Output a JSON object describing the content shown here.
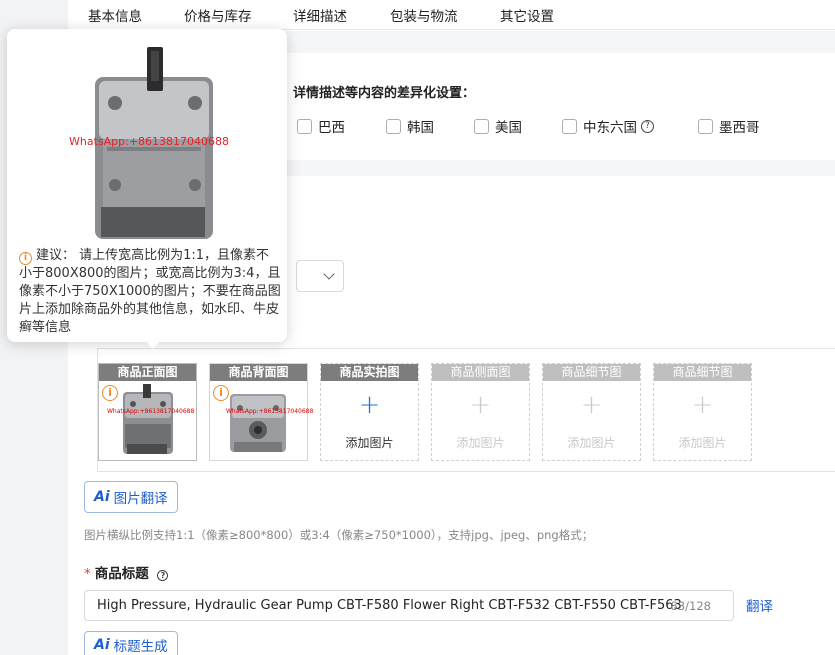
{
  "tabs": [
    "基本信息",
    "价格与库存",
    "详细描述",
    "包装与物流",
    "其它设置"
  ],
  "diff_section": {
    "title": "详情描述等内容的差异化设置：",
    "countries": [
      "巴西",
      "韩国",
      "美国",
      "中东六国",
      "墨西哥"
    ]
  },
  "popover": {
    "watermark": "WhatsApp:+8613817040688",
    "advice": "建议： 请上传宽高比例为1:1，且像素不小于800X800的图片；或宽高比例为3:4，且像素不小于750X1000的图片；不要在商品图片上添加除商品外的其他信息，如水印、牛皮癣等信息"
  },
  "image_slots": [
    {
      "caption": "商品正面图",
      "state": "filled",
      "watermark": "WhatsApp:+8613817040688"
    },
    {
      "caption": "商品背面图",
      "state": "filled",
      "watermark": "WhatsApp:+8613817040688"
    },
    {
      "caption": "商品实拍图",
      "state": "empty",
      "add_label": "添加图片"
    },
    {
      "caption": "商品侧面图",
      "state": "disabled",
      "add_label": "添加图片"
    },
    {
      "caption": "商品细节图",
      "state": "disabled",
      "add_label": "添加图片"
    },
    {
      "caption": "商品细节图",
      "state": "disabled",
      "add_label": "添加图片"
    }
  ],
  "image_translate_button": {
    "icon": "Ai",
    "label": "图片翻译"
  },
  "image_hint": "图片横纵比例支持1:1（像素≥800*800）或3:4（像素≥750*1000），支持jpg、jpeg、png格式；",
  "product_title": {
    "required_mark": "*",
    "label": "商品标题",
    "value": "High Pressure, Hydraulic Gear Pump CBT-F580 Flower Right CBT-F532 CBT-F550 CBT-F563",
    "counter": "83/128",
    "translate": "翻译"
  },
  "title_generate_button": {
    "icon": "Ai",
    "label": "标题生成"
  },
  "colors": {
    "accent": "#1e5fd0",
    "warning": "#f08a24",
    "required": "#e5383b"
  }
}
